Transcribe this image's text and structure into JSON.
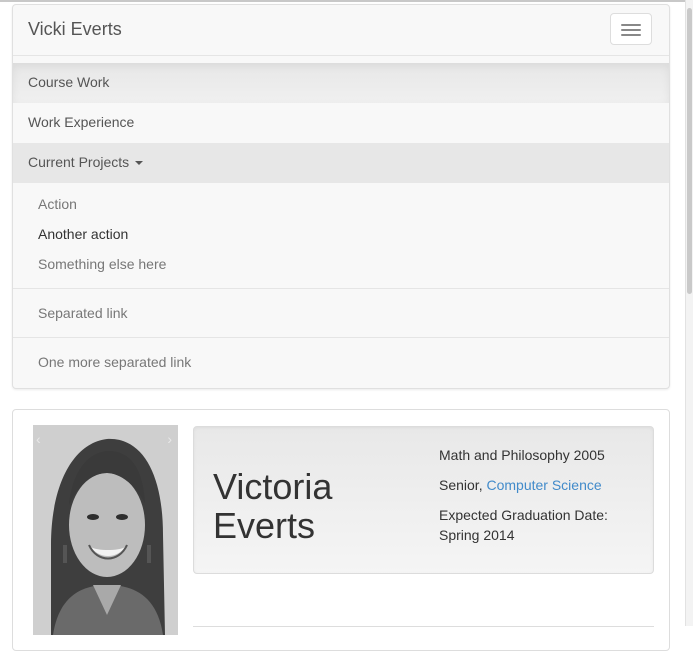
{
  "navbar": {
    "brand": "Vicki Everts",
    "toggle_icon": "hamburger-icon",
    "items": [
      {
        "label": "Course Work",
        "active": true
      },
      {
        "label": "Work Experience"
      },
      {
        "label": "Current Projects",
        "dropdown": true,
        "open": true
      }
    ],
    "dropdown": {
      "items": [
        "Action",
        "Another action",
        "Something else here"
      ],
      "separated": [
        "Separated link",
        "One more separated link"
      ]
    }
  },
  "profile": {
    "first_name": "Victoria",
    "last_name": "Everts",
    "degree": "Math and Philosophy 2005",
    "class_prefix": "Senior, ",
    "major_link": "Computer Science",
    "graduation_label": "Expected Graduation Date:",
    "graduation_value": "Spring 2014",
    "carousel_prev": "‹",
    "carousel_next": "›"
  },
  "colors": {
    "link": "#428bca",
    "navbar_bg": "#f8f8f8",
    "active_bg": "#e7e7e7"
  }
}
